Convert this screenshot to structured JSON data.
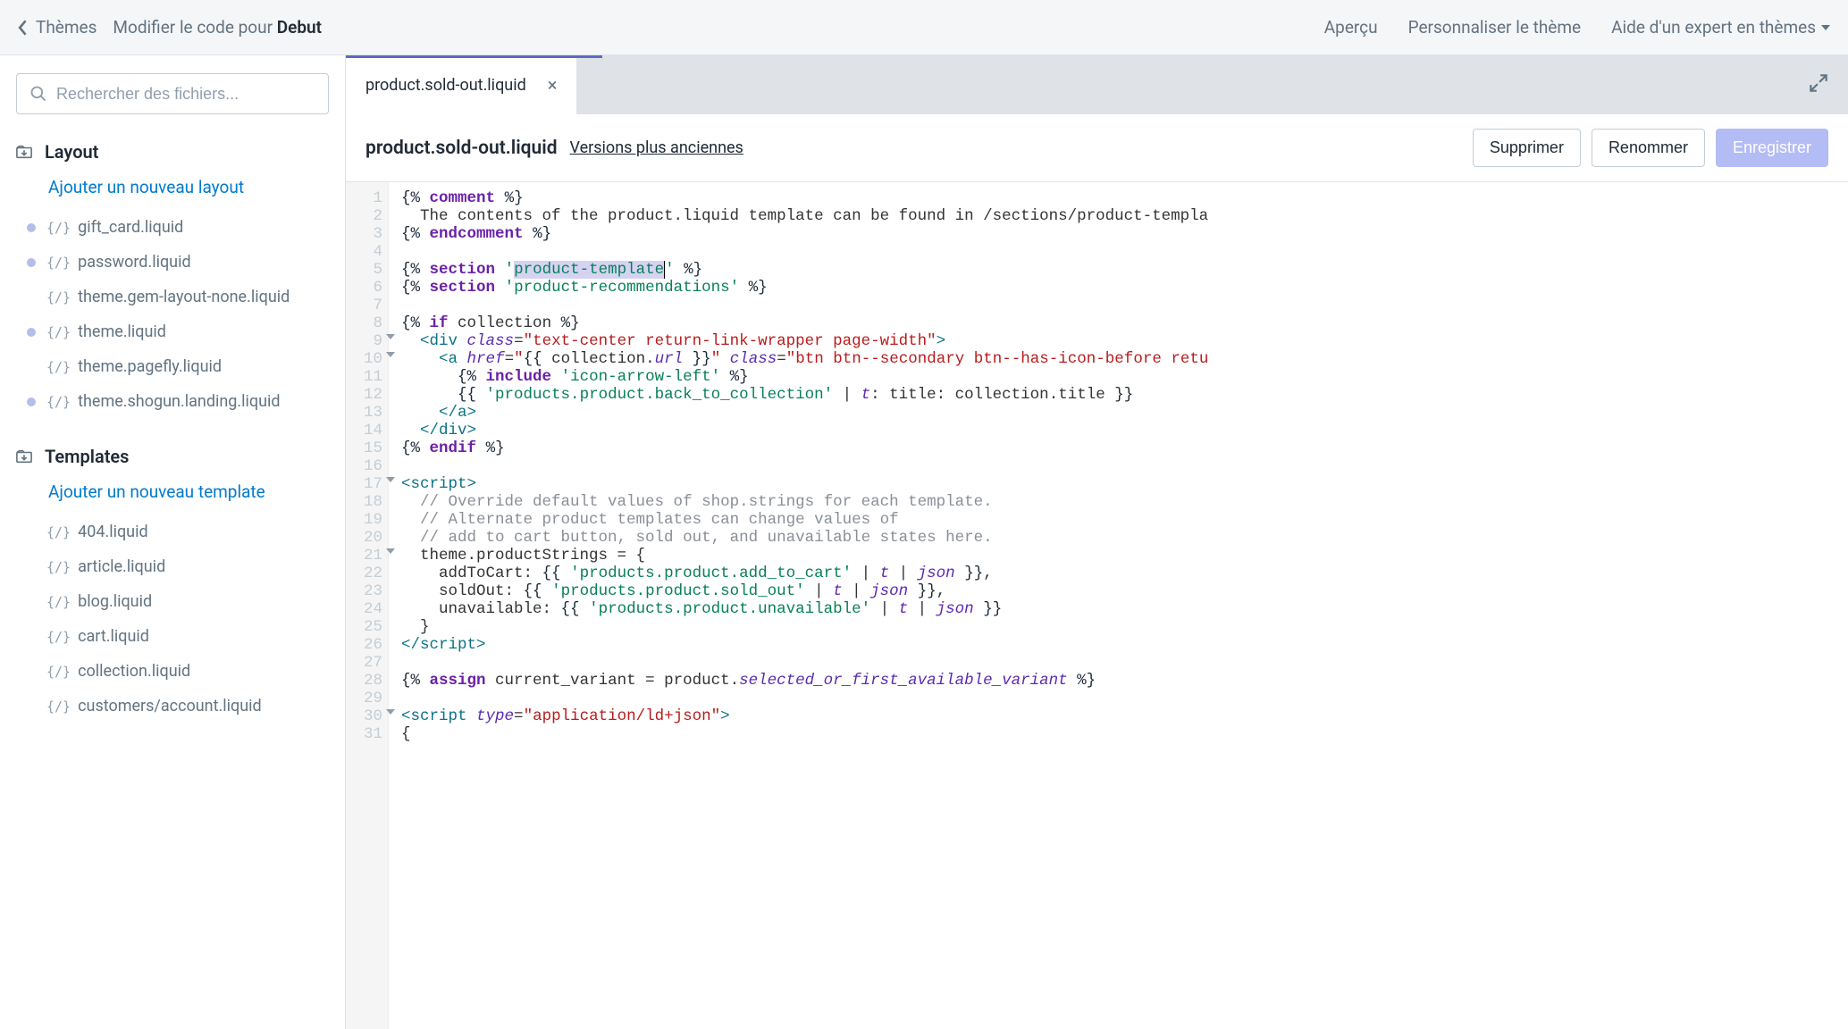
{
  "topbar": {
    "back_label": "Thèmes",
    "title_prefix": "Modifier le code pour ",
    "title_bold": "Debut",
    "links": {
      "preview": "Aperçu",
      "customize": "Personnaliser le thème",
      "expert": "Aide d'un expert en thèmes"
    }
  },
  "sidebar": {
    "search_placeholder": "Rechercher des fichiers...",
    "sections": [
      {
        "name": "Layout",
        "add_label": "Ajouter un nouveau layout",
        "items": [
          {
            "label": "gift_card.liquid",
            "modified": true
          },
          {
            "label": "password.liquid",
            "modified": true
          },
          {
            "label": "theme.gem-layout-none.liquid",
            "modified": false
          },
          {
            "label": "theme.liquid",
            "modified": true
          },
          {
            "label": "theme.pagefly.liquid",
            "modified": false
          },
          {
            "label": "theme.shogun.landing.liquid",
            "modified": true
          }
        ]
      },
      {
        "name": "Templates",
        "add_label": "Ajouter un nouveau template",
        "items": [
          {
            "label": "404.liquid",
            "modified": false
          },
          {
            "label": "article.liquid",
            "modified": false
          },
          {
            "label": "blog.liquid",
            "modified": false
          },
          {
            "label": "cart.liquid",
            "modified": false
          },
          {
            "label": "collection.liquid",
            "modified": false
          },
          {
            "label": "customers/account.liquid",
            "modified": false
          }
        ]
      }
    ]
  },
  "editor": {
    "tab_name": "product.sold-out.liquid",
    "file_title": "product.sold-out.liquid",
    "older_versions": "Versions plus anciennes",
    "buttons": {
      "delete": "Supprimer",
      "rename": "Renommer",
      "save": "Enregistrer"
    },
    "lines": [
      1,
      2,
      3,
      4,
      5,
      6,
      7,
      8,
      9,
      10,
      11,
      12,
      13,
      14,
      15,
      16,
      17,
      18,
      19,
      20,
      21,
      22,
      23,
      24,
      25,
      26,
      27,
      28,
      29,
      30,
      31
    ],
    "fold_lines": [
      9,
      10,
      17,
      21,
      30
    ],
    "code_plain": [
      "{% comment %}",
      "  The contents of the product.liquid template can be found in /sections/product-templa",
      "{% endcomment %}",
      "",
      "{% section 'product-template' %}",
      "{% section 'product-recommendations' %}",
      "",
      "{% if collection %}",
      "  <div class=\"text-center return-link-wrapper page-width\">",
      "    <a href=\"{{ collection.url }}\" class=\"btn btn--secondary btn--has-icon-before retu",
      "      {% include 'icon-arrow-left' %}",
      "      {{ 'products.product.back_to_collection' | t: title: collection.title }}",
      "    </a>",
      "  </div>",
      "{% endif %}",
      "",
      "<script>",
      "  // Override default values of shop.strings for each template.",
      "  // Alternate product templates can change values of",
      "  // add to cart button, sold out, and unavailable states here.",
      "  theme.productStrings = {",
      "    addToCart: {{ 'products.product.add_to_cart' | t | json }},",
      "    soldOut: {{ 'products.product.sold_out' | t | json }},",
      "    unavailable: {{ 'products.product.unavailable' | t | json }}",
      "  }",
      "</script>",
      "",
      "{% assign current_variant = product.selected_or_first_available_variant %}",
      "",
      "<script type=\"application/ld+json\">",
      "{"
    ]
  }
}
